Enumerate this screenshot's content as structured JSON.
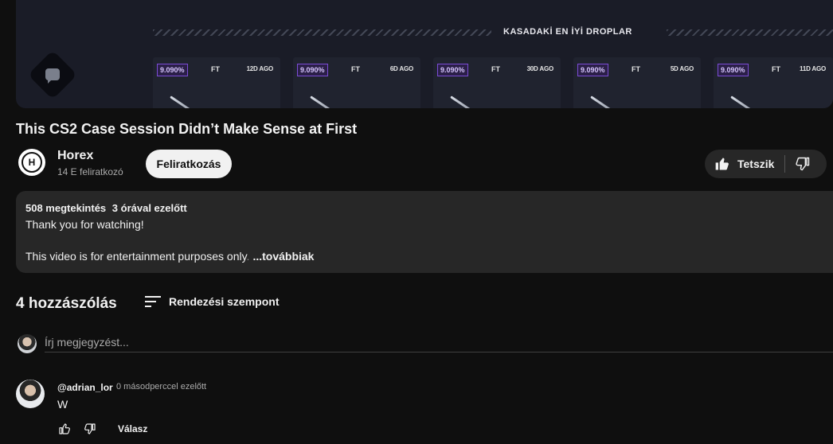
{
  "video": {
    "banner": "KASADAKİ EN İYİ DROPLAR",
    "drops": [
      {
        "pct": "9.090%",
        "currency": "FT",
        "ago": "12D AGO"
      },
      {
        "pct": "9.090%",
        "currency": "FT",
        "ago": "6D AGO"
      },
      {
        "pct": "9.090%",
        "currency": "FT",
        "ago": "30D AGO"
      },
      {
        "pct": "9.090%",
        "currency": "FT",
        "ago": "5D AGO"
      },
      {
        "pct": "9.090%",
        "currency": "FT",
        "ago": "11D AGO"
      }
    ]
  },
  "title": "This CS2 Case Session Didn’t Make Sense at First",
  "channel": {
    "name": "Horex",
    "subscribers": "14 E feliratkozó",
    "subscribe_label": "Feliratkozás"
  },
  "actions": {
    "like_label": "Tetszik"
  },
  "description": {
    "views": "508 megtekintés",
    "time": "3 órával ezelőtt",
    "line1": "Thank you for watching!",
    "line2": "This video is for entertainment purposes only",
    "line2_fade": ".",
    "more": "...továbbiak"
  },
  "comments": {
    "count": "4 hozzászólás",
    "sort_label": "Rendezési szempont",
    "add_placeholder": "Írj megjegyzést...",
    "items": [
      {
        "user": "@adrian_lor",
        "time": "0 másodperccel ezelőtt",
        "text": "W",
        "reply_label": "Válasz"
      }
    ]
  },
  "colors": {
    "background": "#0f0f0f",
    "surface": "#272727",
    "accent_purple": "#7b4cd6"
  },
  "icons": [
    "chat-bubble-icon",
    "like-icon",
    "dislike-icon",
    "sort-icon"
  ]
}
